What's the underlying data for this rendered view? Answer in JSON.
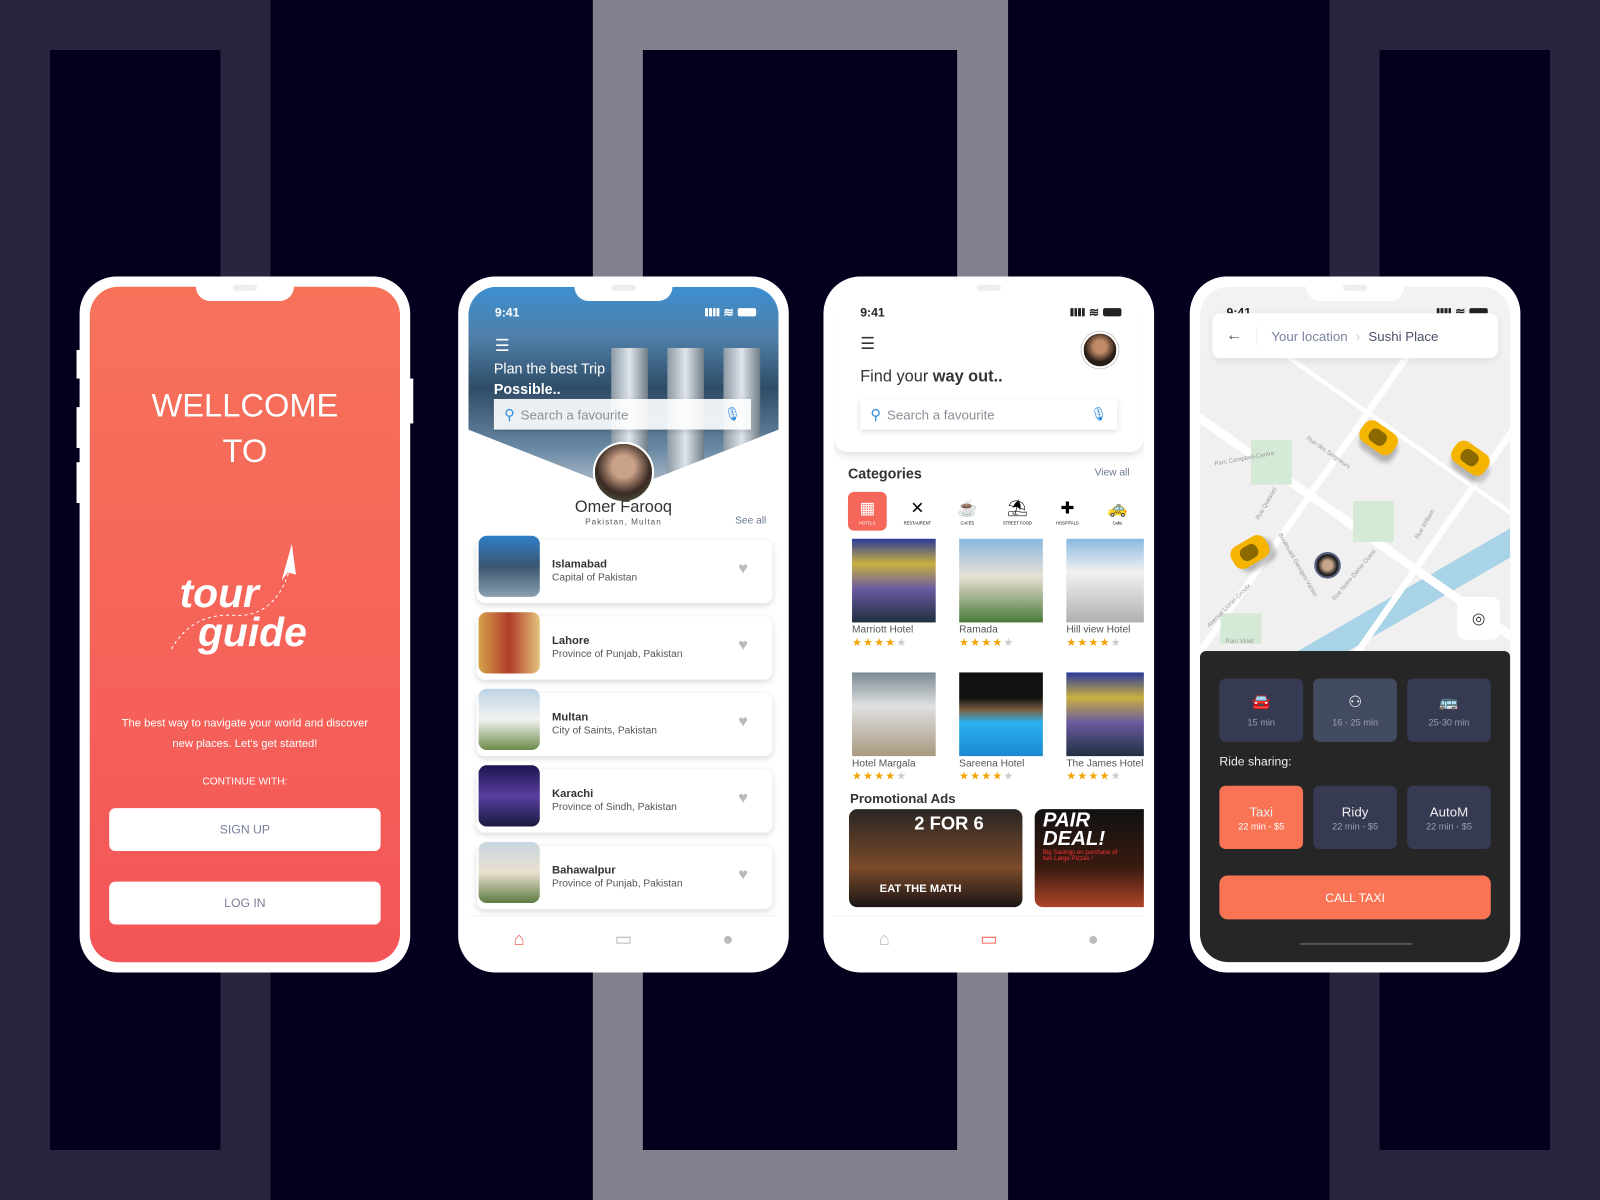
{
  "welcome": {
    "title_line1": "WELLCOME",
    "title_line2": "TO",
    "logo_text": "tour guide",
    "tagline": "The best way to navigate your world and discover new places. Let's get started!",
    "continue_with": "CONTINUE WITH:",
    "sign_up": "SIGN UP",
    "log_in": "LOG IN",
    "accent": "#f5675a"
  },
  "home": {
    "time": "9:41",
    "headline1": "Plan the best Trip",
    "headline2": "Possible..",
    "search_placeholder": "Search a favourite",
    "user_name": "Omer Farooq",
    "user_location": "Pakistan, Multan",
    "see_all": "See all",
    "places": [
      {
        "name": "Islamabad",
        "desc": "Capital of Pakistan"
      },
      {
        "name": "Lahore",
        "desc": "Province of Punjab, Pakistan"
      },
      {
        "name": "Multan",
        "desc": "City of Saints, Pakistan"
      },
      {
        "name": "Karachi",
        "desc": "Province of Sindh, Pakistan"
      },
      {
        "name": "Bahawalpur",
        "desc": "Province of Punjab, Pakistan"
      }
    ],
    "nav": [
      "home-icon",
      "wallet-icon",
      "user-icon"
    ],
    "active_nav": "home"
  },
  "explore": {
    "time": "9:41",
    "headline_light": "Find your ",
    "headline_bold": "way out..",
    "search_placeholder": "Search a favourite",
    "categories_title": "Categories",
    "view_all": "View all",
    "categories": [
      {
        "label": "HOTELS",
        "icon": "hotel-icon",
        "active": true
      },
      {
        "label": "RESTAURENT",
        "icon": "utensils-icon"
      },
      {
        "label": "CAFES",
        "icon": "coffee-icon"
      },
      {
        "label": "STREET FOOD",
        "icon": "food-cart-icon"
      },
      {
        "label": "HOSPITALS",
        "icon": "medical-kit-icon"
      },
      {
        "label": "Cabs",
        "icon": "taxi-icon"
      }
    ],
    "hotels": [
      {
        "name": "Marriott Hotel",
        "rating": 4
      },
      {
        "name": "Ramada",
        "rating": 4
      },
      {
        "name": "Hill view Hotel",
        "rating": 4
      },
      {
        "name": "Hotel Margala",
        "rating": 4
      },
      {
        "name": "Sareena Hotel",
        "rating": 4
      },
      {
        "name": "The James Hotel",
        "rating": 4
      }
    ],
    "promo_title": "Promotional Ads",
    "ads": [
      {
        "headline": "2 FOR 6",
        "sub": "EAT THE MATH"
      },
      {
        "headline": "PAIR DEAL!",
        "sub": "Big Savings on purchase of two Large Pizzas !"
      }
    ],
    "active_nav": "wallet"
  },
  "ride": {
    "time": "9:41",
    "from": "Your location",
    "to": "Sushi Place",
    "modes": [
      {
        "icon": "car-icon",
        "time": "15 min"
      },
      {
        "icon": "ride-share-icon",
        "time": "16 - 25 min",
        "selected": true
      },
      {
        "icon": "bus-icon",
        "time": "25-30 min"
      }
    ],
    "ride_sharing_label": "Ride sharing:",
    "services": [
      {
        "name": "Taxi",
        "detail": "22 min - $5",
        "selected": true
      },
      {
        "name": "Ridy",
        "detail": "22 min - $5"
      },
      {
        "name": "AutoM",
        "detail": "22 min - $5"
      }
    ],
    "call_button": "CALL TAXI",
    "map_labels": [
      "Parc Campbell-Centre",
      "Rue des Seigneurs",
      "Rue Quesnel",
      "Boulevard Georges-Vanier",
      "Rue Notre-Dame Ouest",
      "Rue William",
      "Avenue Lionel-Groulx",
      "Parc Vinet"
    ]
  }
}
